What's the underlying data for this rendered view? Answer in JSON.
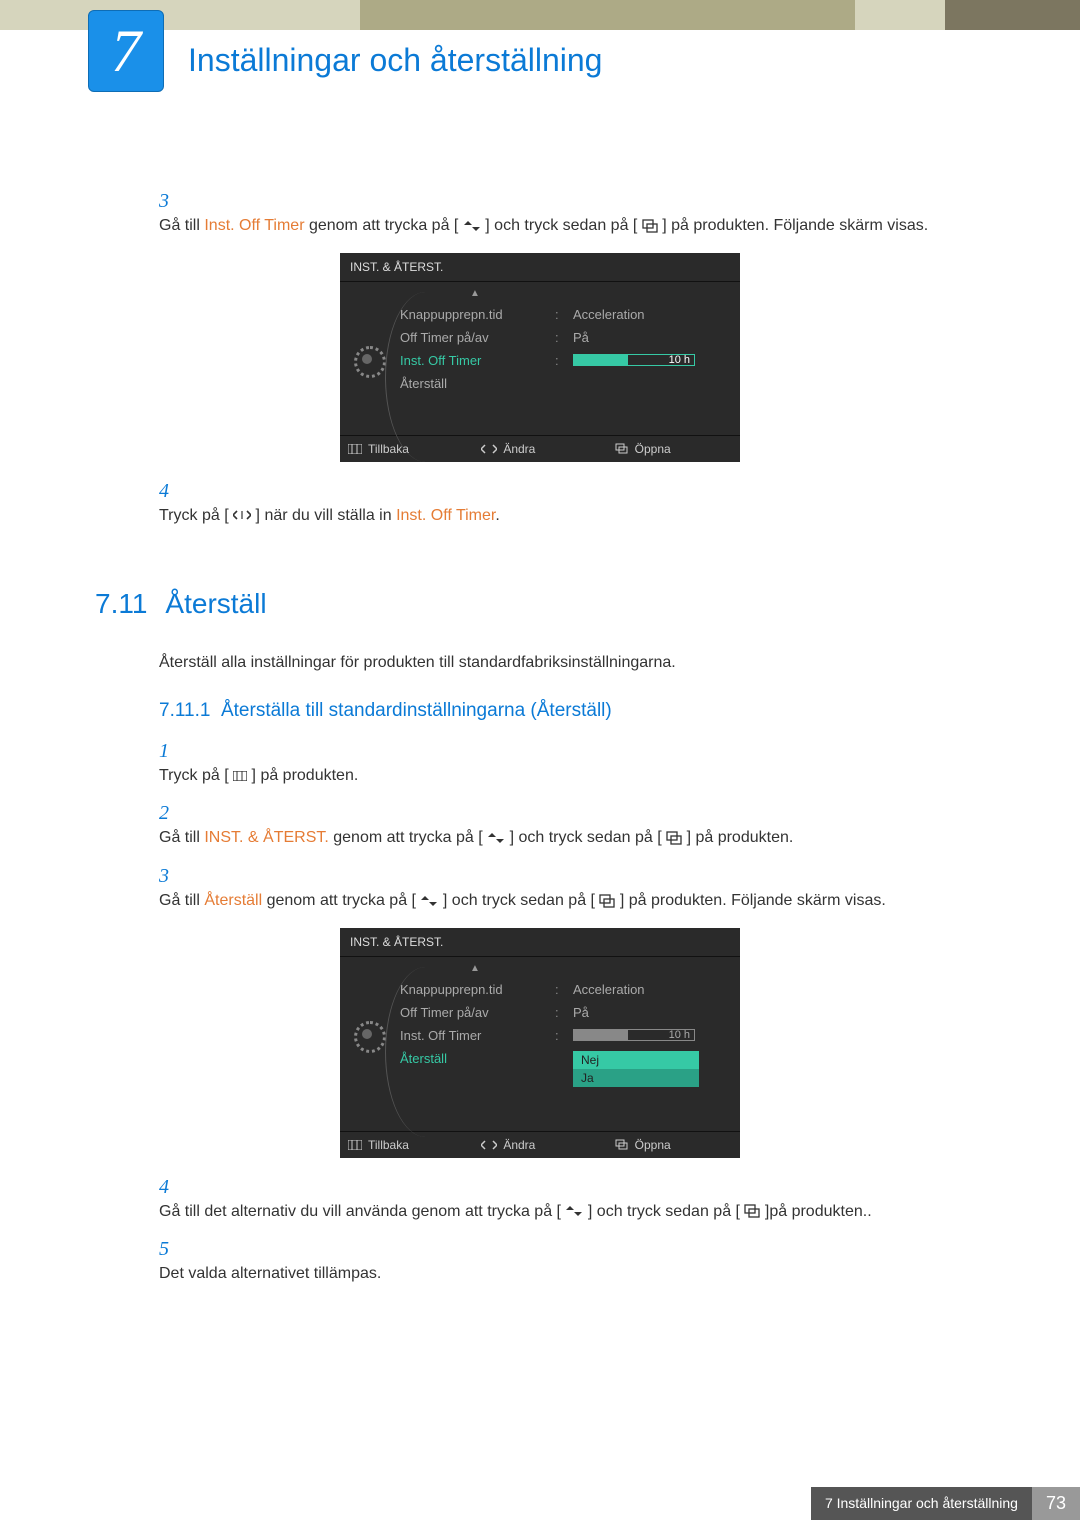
{
  "chapter": {
    "number": "7",
    "title": "Inställningar och återställning"
  },
  "section1": {
    "step3": {
      "num": "3",
      "pre": "Gå till ",
      "orange": "Inst. Off Timer",
      "mid": " genom att trycka på [",
      "mid2": "] och tryck sedan på [",
      "post": "] på produkten. Följande skärm visas."
    },
    "osd1": {
      "title": "INST. & ÅTERST.",
      "rows": [
        {
          "label": "Knappupprepn.tid",
          "value": "Acceleration"
        },
        {
          "label": "Off Timer på/av",
          "value": "På"
        },
        {
          "label": "Inst. Off Timer",
          "value": "10 h",
          "selected": true,
          "slider": true,
          "fill": 45
        },
        {
          "label": "Återställ",
          "value": ""
        }
      ],
      "footer": {
        "back": "Tillbaka",
        "change": "Ändra",
        "open": "Öppna"
      }
    },
    "step4": {
      "num": "4",
      "pre": "Tryck på [",
      "mid": "] när du vill ställa in ",
      "orange": "Inst. Off Timer",
      "post": "."
    }
  },
  "section711": {
    "num": "7.11",
    "title": "Återställ",
    "desc": "Återställ alla inställningar för produkten till standardfabriksinställningarna.",
    "sub": {
      "num": "7.11.1",
      "title": "Återställa till standardinställningarna (Återställ)"
    },
    "step1": {
      "num": "1",
      "pre": "Tryck på [",
      "post": "] på produkten."
    },
    "step2": {
      "num": "2",
      "pre": "Gå till ",
      "orange": "INST. & ÅTERST.",
      "mid": " genom att trycka på [",
      "mid2": "] och tryck sedan på [",
      "post": "] på produkten."
    },
    "step3": {
      "num": "3",
      "pre": "Gå till ",
      "orange": "Återställ",
      "mid": " genom att trycka på [",
      "mid2": "] och tryck sedan på [",
      "post": "] på produkten. Följande skärm visas."
    },
    "osd2": {
      "title": "INST. & ÅTERST.",
      "rows": [
        {
          "label": "Knappupprepn.tid",
          "value": "Acceleration"
        },
        {
          "label": "Off Timer på/av",
          "value": "På"
        },
        {
          "label": "Inst. Off Timer",
          "value": "10 h",
          "slider": true,
          "fill": 45
        },
        {
          "label": "Återställ",
          "value": "",
          "selected": true,
          "dropdown": [
            "Nej",
            "Ja"
          ]
        }
      ],
      "footer": {
        "back": "Tillbaka",
        "change": "Ändra",
        "open": "Öppna"
      }
    },
    "step4": {
      "num": "4",
      "pre": "Gå till det alternativ du vill använda genom att trycka på [",
      "mid": "] och tryck sedan på [",
      "post": "]på produkten.."
    },
    "step5": {
      "num": "5",
      "text": "Det valda alternativet tillämpas."
    }
  },
  "footer": {
    "label": "7 Inställningar och återställning",
    "page": "73"
  }
}
